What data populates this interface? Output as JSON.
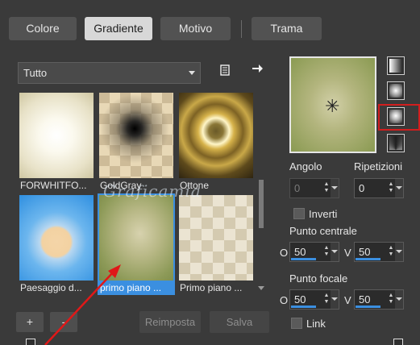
{
  "tabs": [
    "Colore",
    "Gradiente",
    "Motivo",
    "Trama"
  ],
  "active_tab": "Gradiente",
  "category_select": "Tutto",
  "thumbnails": [
    {
      "label": "FORWHITFO..."
    },
    {
      "label": "GoldGray"
    },
    {
      "label": "Ottone"
    },
    {
      "label": "Paesaggio d..."
    },
    {
      "label": "primo piano ..."
    },
    {
      "label": "Primo piano ..."
    }
  ],
  "watermark": "Graficamia",
  "buttons": {
    "add": "+",
    "remove": "-",
    "reset": "Reimposta",
    "save": "Salva"
  },
  "settings": {
    "angle_label": "Angolo",
    "angle_value": "0",
    "repeats_label": "Ripetizioni",
    "repeats_value": "0",
    "invert_label": "Inverti",
    "center_label": "Punto centrale",
    "center_o_label": "O",
    "center_o_value": "50",
    "center_v_label": "V",
    "center_v_value": "50",
    "focal_label": "Punto focale",
    "focal_o_label": "O",
    "focal_o_value": "50",
    "focal_v_label": "V",
    "focal_v_value": "50",
    "link_label": "Link"
  },
  "colors": {
    "accent": "#3b8fe0",
    "highlight_box": "#d11e1e",
    "arrow": "#e01818"
  }
}
